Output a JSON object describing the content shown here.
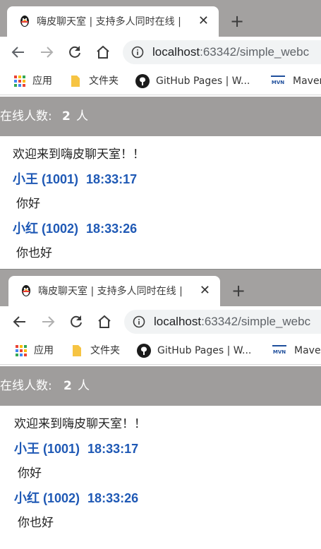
{
  "windows": [
    {
      "tab": {
        "title": "嗨皮聊天室 | 支持多人同时在线 |",
        "close": "✕"
      },
      "new_tab": "+",
      "url": {
        "host": "localhost",
        "rest": ":63342/simple_webc"
      },
      "bookmarks": [
        {
          "label": "应用",
          "icon": "apps-grid-icon"
        },
        {
          "label": "文件夹",
          "icon": "folder-icon"
        },
        {
          "label": "GitHub Pages | W...",
          "icon": "github-icon"
        },
        {
          "label": "Maven",
          "icon": "maven-icon"
        }
      ],
      "online": {
        "label": "在线人数:",
        "count": "2",
        "unit": "人"
      },
      "welcome": "欢迎来到嗨皮聊天室！！",
      "messages": [
        {
          "sender": "小王 (1001)",
          "time": "18:33:17",
          "text": "你好"
        },
        {
          "sender": "小红 (1002)",
          "time": "18:33:26",
          "text": "你也好"
        }
      ]
    },
    {
      "tab": {
        "title": "嗨皮聊天室 | 支持多人同时在线 |",
        "close": "✕"
      },
      "new_tab": "+",
      "url": {
        "host": "localhost",
        "rest": ":63342/simple_webc"
      },
      "bookmarks": [
        {
          "label": "应用",
          "icon": "apps-grid-icon"
        },
        {
          "label": "文件夹",
          "icon": "folder-icon"
        },
        {
          "label": "GitHub Pages | W...",
          "icon": "github-icon"
        },
        {
          "label": "Maven",
          "icon": "maven-icon"
        }
      ],
      "online": {
        "label": "在线人数:",
        "count": "2",
        "unit": "人"
      },
      "welcome": "欢迎来到嗨皮聊天室！！",
      "messages": [
        {
          "sender": "小王 (1001)",
          "time": "18:33:17",
          "text": "你好"
        },
        {
          "sender": "小红 (1002)",
          "time": "18:33:26",
          "text": "你也好"
        }
      ]
    }
  ],
  "colors": {
    "tab_strip": "#a3a1a0",
    "online_bar": "#9f9d9c",
    "sender": "#1f59b5",
    "omnibox": "#f1f3f4"
  }
}
